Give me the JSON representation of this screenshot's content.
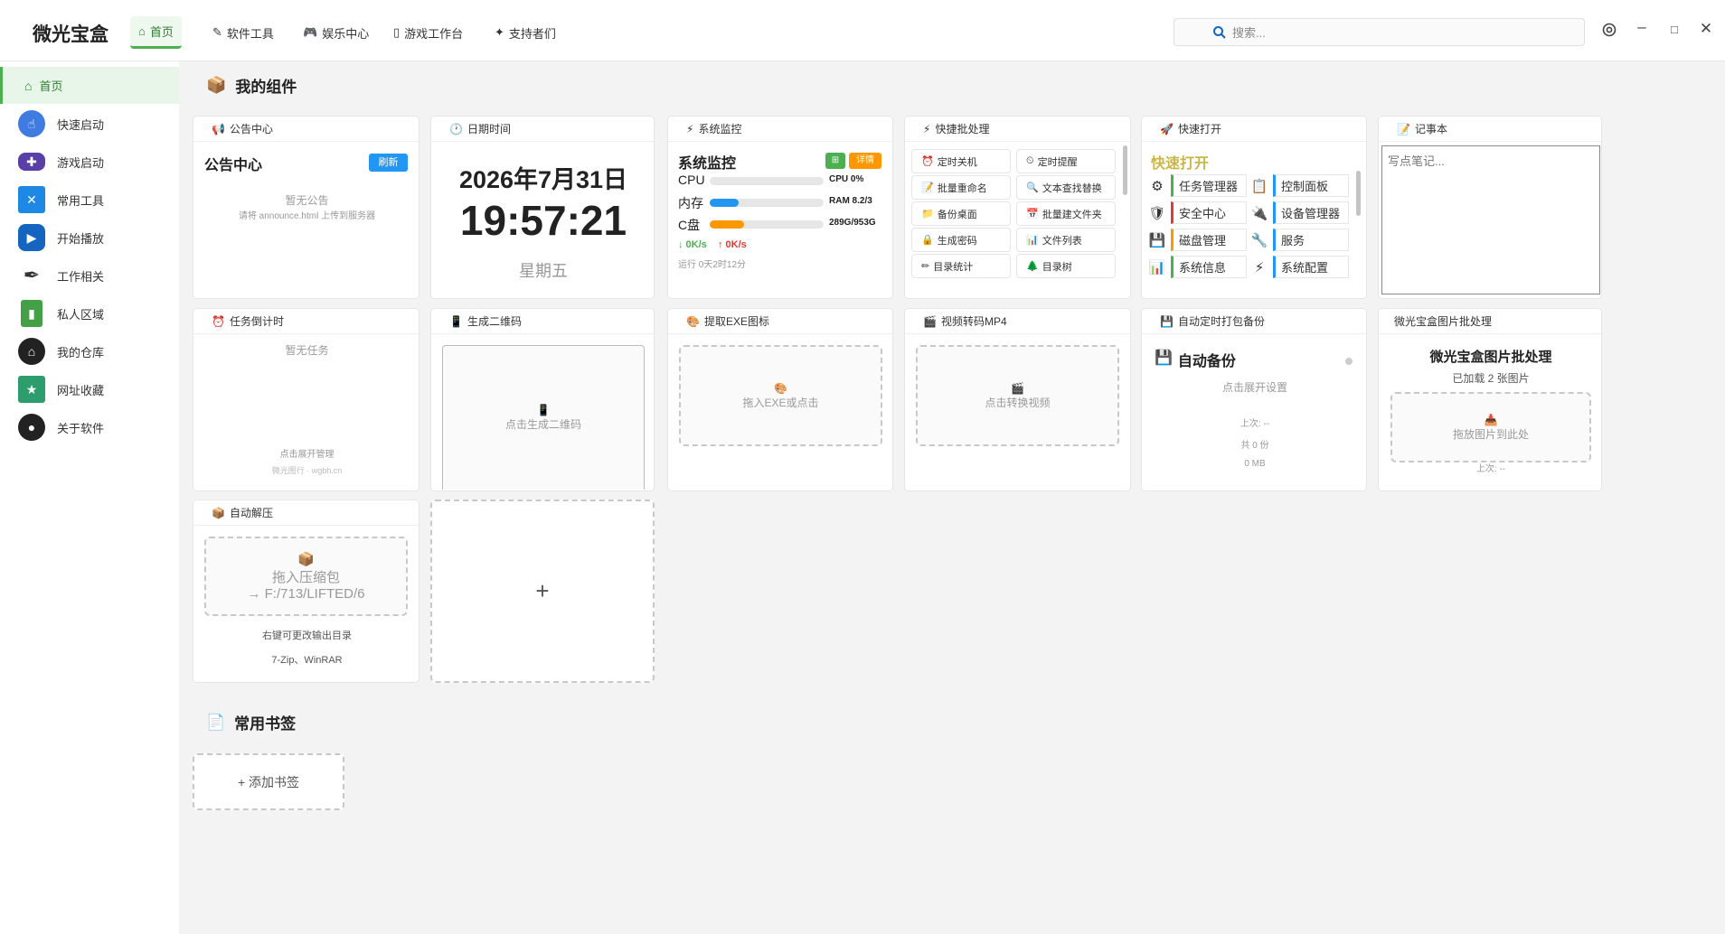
{
  "app": {
    "title": "微光宝盒"
  },
  "nav": {
    "tabs": [
      {
        "icon": "⌂",
        "label": "首页"
      },
      {
        "icon": "✎",
        "label": "软件工具"
      },
      {
        "icon": "🎮",
        "label": "娱乐中心"
      },
      {
        "icon": "▯",
        "label": "游戏工作台"
      },
      {
        "icon": "✦",
        "label": "支持者们"
      }
    ]
  },
  "search": {
    "placeholder": "搜索..."
  },
  "sidebar": {
    "items": [
      {
        "label": "首页",
        "color": "#4caf50"
      },
      {
        "label": "快速启动",
        "color": "#3f7be0"
      },
      {
        "label": "游戏启动",
        "color": "#5b3fa8"
      },
      {
        "label": "常用工具",
        "color": "#1e88e5"
      },
      {
        "label": "开始播放",
        "color": "#1565c0"
      },
      {
        "label": "工作相关",
        "color": "#333333"
      },
      {
        "label": "私人区域",
        "color": "#43a047"
      },
      {
        "label": "我的仓库",
        "color": "#222222"
      },
      {
        "label": "网址收藏",
        "color": "#2e9d6e"
      },
      {
        "label": "关于软件",
        "color": "#222222"
      }
    ]
  },
  "sections": {
    "widgets": "我的组件",
    "bookmarks": "常用书签"
  },
  "announce": {
    "header": "公告中心",
    "title": "公告中心",
    "refresh": "刷新",
    "empty": "暂无公告",
    "hint": "请将 announce.html 上传到服务器"
  },
  "datetime": {
    "header": "日期时间",
    "date": "2026年7月31日",
    "time": "19:57:21",
    "weekday": "星期五"
  },
  "sysmon": {
    "header": "系统监控",
    "title": "系统监控",
    "btn1": "⊞",
    "btn2": "详情",
    "rows": [
      {
        "label": "CPU",
        "value": "CPU 0%",
        "fill": 0.0,
        "color": "#2196f3"
      },
      {
        "label": "内存",
        "value": "RAM 8.2/3",
        "fill": 0.25,
        "color": "#2196f3"
      },
      {
        "label": "C盘",
        "value": "289G/953G",
        "fill": 0.3,
        "color": "#ff9800"
      }
    ],
    "down": "↓ 0K/s",
    "up": "↑ 0K/s",
    "uptime": "运行 0天2时12分"
  },
  "batch": {
    "header": "快捷批处理",
    "items": [
      {
        "icon": "⏰",
        "label": "定时关机"
      },
      {
        "icon": "⏲",
        "label": "定时提醒"
      },
      {
        "icon": "📝",
        "label": "批量重命名"
      },
      {
        "icon": "🔍",
        "label": "文本查找替换"
      },
      {
        "icon": "📁",
        "label": "备份桌面"
      },
      {
        "icon": "📅",
        "label": "批量建文件夹"
      },
      {
        "icon": "🔒",
        "label": "生成密码"
      },
      {
        "icon": "📊",
        "label": "文件列表"
      },
      {
        "icon": "✏",
        "label": "目录统计"
      },
      {
        "icon": "🌲",
        "label": "目录树"
      }
    ]
  },
  "quickopen": {
    "header": "快速打开",
    "title": "快速打开",
    "items": [
      {
        "icon": "⚙",
        "label": "任务管理器"
      },
      {
        "icon": "📋",
        "label": "控制面板"
      },
      {
        "icon": "🛡",
        "label": "安全中心"
      },
      {
        "icon": "🔌",
        "label": "设备管理器"
      },
      {
        "icon": "💾",
        "label": "磁盘管理"
      },
      {
        "icon": "🔧",
        "label": "服务"
      },
      {
        "icon": "📊",
        "label": "系统信息"
      },
      {
        "icon": "⚡",
        "label": "系统配置"
      }
    ]
  },
  "notes": {
    "header": "记事本",
    "placeholder": "写点笔记..."
  },
  "countdown": {
    "header": "任务倒计时",
    "empty": "暂无任务",
    "manage": "点击展开管理",
    "footer": "微光图行 · wgbh.cn"
  },
  "qrcode": {
    "header": "生成二维码",
    "hint": "点击生成二维码"
  },
  "exeicon": {
    "header": "提取EXE图标",
    "hint": "拖入EXE或点击"
  },
  "video": {
    "header": "视频转码MP4",
    "hint": "点击转换视频"
  },
  "backup": {
    "header": "自动定时打包备份",
    "title": "自动备份",
    "setting": "点击展开设置",
    "last": "上次: --",
    "count": "共 0 份",
    "size": "0 MB"
  },
  "imagebatch": {
    "header": "微光宝盒图片批处理",
    "title": "微光宝盒图片批处理",
    "loaded": "已加载 2 张图片",
    "drop": "拖放图片到此处",
    "last": "上次: --"
  },
  "unzip": {
    "header": "自动解压",
    "drop1": "拖入压缩包",
    "drop2": "→ F:/713/LIFTED/6",
    "hint": "右键可更改输出目录",
    "formats": "7-Zip、WinRAR"
  },
  "addwidget": {
    "label": "+"
  },
  "addbookmark": {
    "label": "+ 添加书签"
  }
}
